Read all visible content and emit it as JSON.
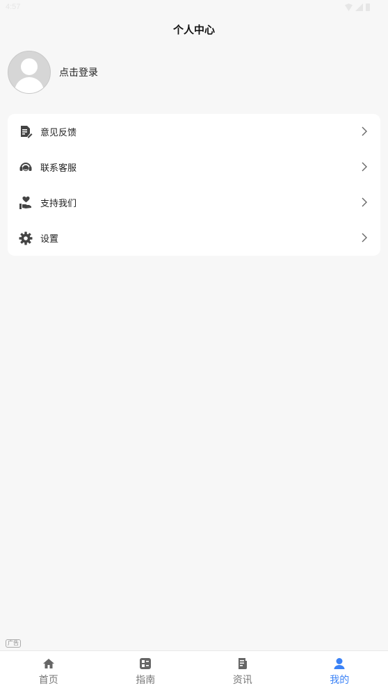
{
  "status": {
    "time": "4:57"
  },
  "header": {
    "title": "个人中心"
  },
  "profile": {
    "login_label": "点击登录"
  },
  "menu": {
    "items": [
      {
        "label": "意见反馈",
        "icon": "feedback-doc-icon"
      },
      {
        "label": "联系客服",
        "icon": "headset-icon"
      },
      {
        "label": "支持我们",
        "icon": "hand-heart-icon"
      },
      {
        "label": "设置",
        "icon": "gear-icon"
      }
    ]
  },
  "ad": {
    "label": "广告"
  },
  "tabs": {
    "items": [
      {
        "label": "首页",
        "icon": "home-icon",
        "active": false
      },
      {
        "label": "指南",
        "icon": "grid-icon",
        "active": false
      },
      {
        "label": "资讯",
        "icon": "news-icon",
        "active": false
      },
      {
        "label": "我的",
        "icon": "user-icon",
        "active": true
      }
    ]
  },
  "colors": {
    "accent": "#3b82f6",
    "icon_gray": "#444444",
    "tab_gray": "#777777",
    "background": "#f7f7f7"
  }
}
